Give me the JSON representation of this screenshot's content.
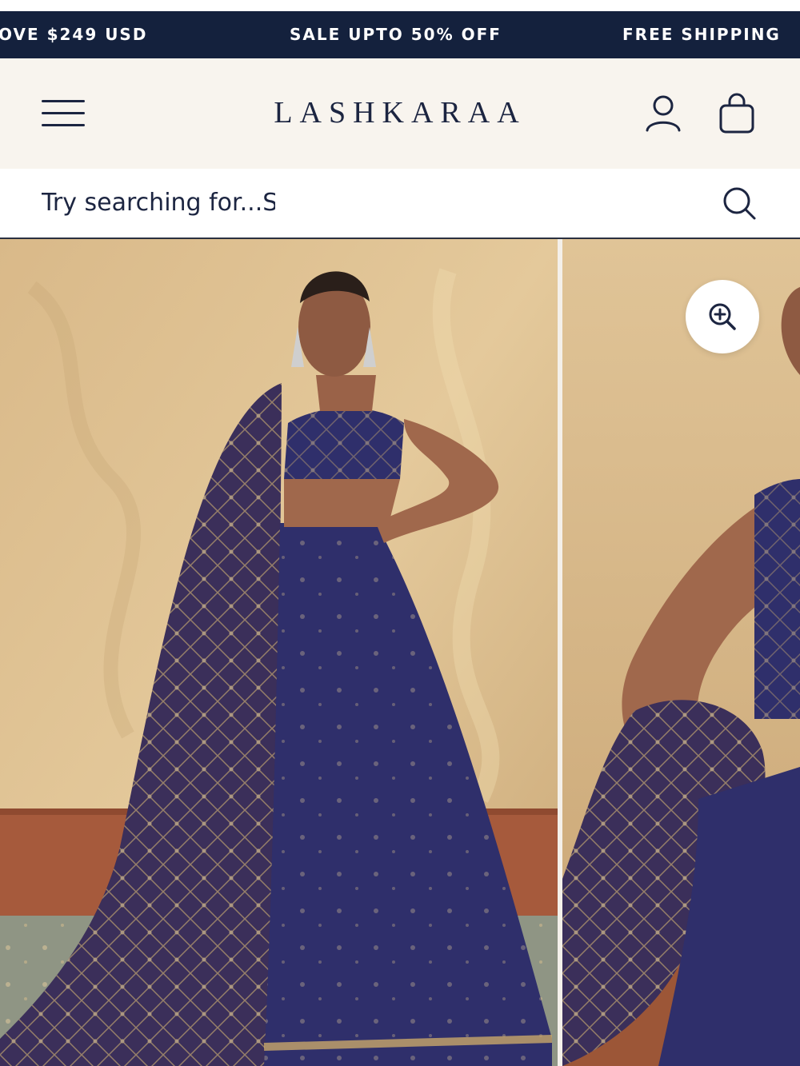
{
  "promo_bar": {
    "messages": [
      "OVE $249 USD",
      "SALE UPTO 50% OFF",
      "FREE SHIPPING"
    ]
  },
  "header": {
    "brand": "LASHKARAA",
    "icons": [
      "menu-icon",
      "user-icon",
      "shopping-bag-icon"
    ]
  },
  "search": {
    "placeholder": "Try searching for...Su",
    "icon": "search-icon"
  },
  "gallery": {
    "icons": [
      "zoom-in-icon"
    ]
  },
  "colors": {
    "navy": "#14213d",
    "header_bg": "#f8f4ee",
    "text": "#1c2541",
    "lehenga": "#2f2f6b"
  }
}
